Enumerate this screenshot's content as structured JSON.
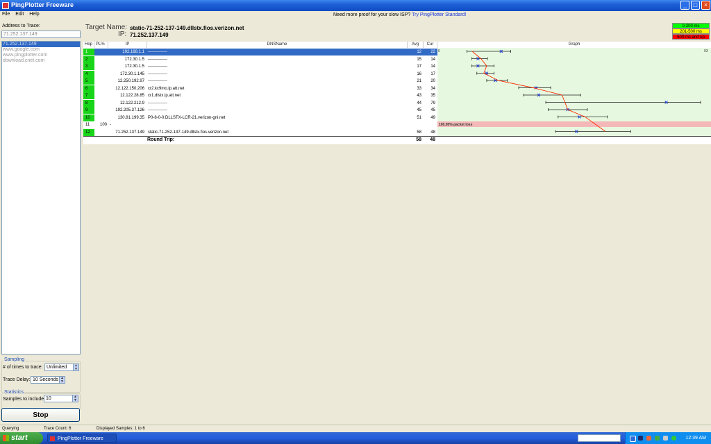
{
  "window": {
    "title": "PingPlotter Freeware"
  },
  "menu": {
    "file": "File",
    "edit": "Edit",
    "help": "Help"
  },
  "promo": {
    "text": "Need more proof for your slow ISP?",
    "link": "Try PingPlotter Standard!"
  },
  "left": {
    "address_label": "Address to Trace:",
    "address_value": "71.252.137.149",
    "history": [
      "71.252.137.149",
      "www.google.com",
      "www.pingplotter.com",
      "download.cnet.com"
    ],
    "sampling_title": "Sampling",
    "times_label": "# of times to trace:",
    "times_value": "Unlimited",
    "delay_label": "Trace Delay:",
    "delay_value": "10 Seconds",
    "statistics_title": "Statistics",
    "samples_label": "Samples to include:",
    "samples_value": "10",
    "stop_label": "Stop"
  },
  "target": {
    "name_label": "Target Name:",
    "name_value": "static-71-252-137-149.dllstx.fios.verizon.net",
    "ip_label": "IP:",
    "ip_value": "71.252.137.149"
  },
  "legend": [
    {
      "label": "0-200 ms",
      "color": "#00ff00"
    },
    {
      "label": "201-500 ms",
      "color": "#ffff00"
    },
    {
      "label": "500 ms and up",
      "color": "#ff0000"
    }
  ],
  "table": {
    "headers": {
      "hop": "Hop",
      "pl": "PL%",
      "ip": "IP",
      "dns": "DNSName",
      "avg": "Avg",
      "cur": "Cur",
      "graph": "Graph"
    },
    "rows": [
      {
        "hop": "1",
        "pl": "",
        "ip": "192.168.1.1",
        "dns": "--------------",
        "avg": "12",
        "cur": "22"
      },
      {
        "hop": "2",
        "pl": "",
        "ip": "172.30.1.5",
        "dns": "--------------",
        "avg": "15",
        "cur": "14"
      },
      {
        "hop": "3",
        "pl": "",
        "ip": "172.30.1.5",
        "dns": "--------------",
        "avg": "17",
        "cur": "14"
      },
      {
        "hop": "4",
        "pl": "",
        "ip": "172.30.1.145",
        "dns": "--------------",
        "avg": "16",
        "cur": "17"
      },
      {
        "hop": "5",
        "pl": "",
        "ip": "12.250.192.97",
        "dns": "--------------",
        "avg": "21",
        "cur": "20"
      },
      {
        "hop": "6",
        "pl": "",
        "ip": "12.122.150.206",
        "dns": "cr2.kc9mo.ip.att.net",
        "avg": "33",
        "cur": "34"
      },
      {
        "hop": "7",
        "pl": "",
        "ip": "12.122.28.85",
        "dns": "cr1.dlstx.ip.att.net",
        "avg": "43",
        "cur": "35"
      },
      {
        "hop": "8",
        "pl": "",
        "ip": "12.122.212.9",
        "dns": "--------------",
        "avg": "44",
        "cur": "79"
      },
      {
        "hop": "9",
        "pl": "",
        "ip": "192.205.37.126",
        "dns": "--------------",
        "avg": "45",
        "cur": "45"
      },
      {
        "hop": "10",
        "pl": "",
        "ip": "130.81.199.35",
        "dns": "P0-8-0-0.DLLSTX-LCR-21.verizon-gni.net",
        "avg": "51",
        "cur": "49"
      },
      {
        "hop": "11",
        "pl": "100",
        "ip": "-",
        "dns": "",
        "avg": "",
        "cur": ""
      },
      {
        "hop": "12",
        "pl": "",
        "ip": "71.252.137.149",
        "dns": "static-71-252-137-149.dllstx.fios.verizon.net",
        "avg": "58",
        "cur": "48"
      }
    ],
    "roundtrip": {
      "label": "Round Trip:",
      "avg": "58",
      "cur": "48"
    }
  },
  "graph": {
    "scale_min": "0",
    "scale_max": "93",
    "packet_loss_label": "100.00% packet loss",
    "colors": {
      "line": "#ff2a00",
      "bg": "#e6f9e0",
      "loss": "#f4b8b8",
      "marker": "#1a3adb"
    }
  },
  "status": {
    "state": "Querying",
    "trace_count": "Trace Count: 6",
    "displayed": "Displayed Samples: 1 to 6"
  },
  "taskbar": {
    "start": "start",
    "task": "PingPlotter Freeware",
    "clock": "12:39 AM"
  }
}
